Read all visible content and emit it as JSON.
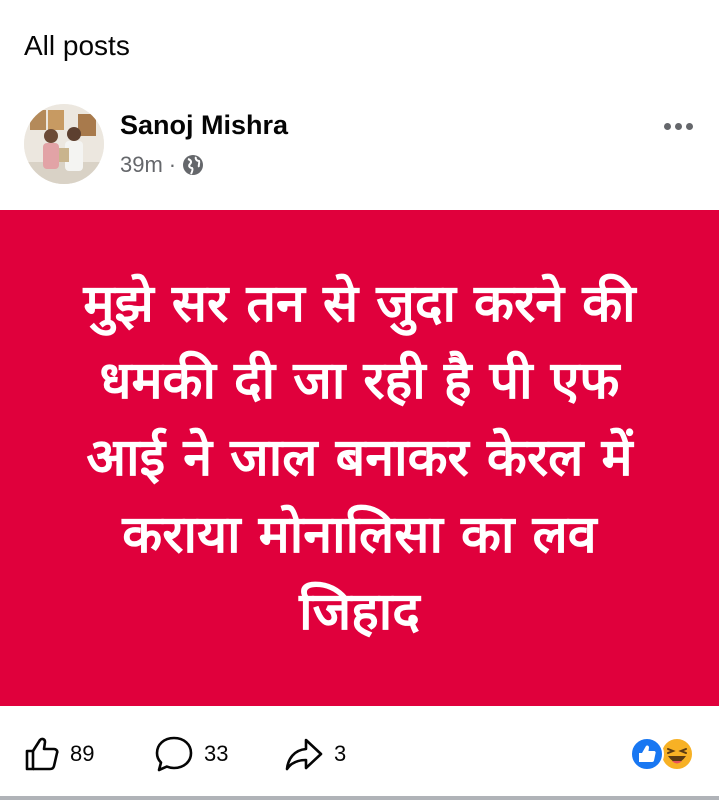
{
  "header": {
    "title": "All posts"
  },
  "post": {
    "author": "Sanoj Mishra",
    "time": "39m",
    "separator": "·",
    "privacy_icon": "globe-icon",
    "more_icon": "more-horizontal-icon",
    "avatar_description": "photo-avatar",
    "text": "मुझे सर तन से जुदा करने की धमकी दी जा रही है पी एफ आई ने जाल बनाकर केरल में कराया मोनालिसा का  लव जिहाद",
    "background_color": "#e0003c",
    "text_color": "#ffffff"
  },
  "actions": {
    "like": {
      "icon": "like-icon",
      "count": "89"
    },
    "comment": {
      "icon": "comment-icon",
      "count": "33"
    },
    "share": {
      "icon": "share-icon",
      "count": "3"
    }
  },
  "reactions": {
    "icons": [
      "like-reaction-icon",
      "haha-reaction-icon"
    ]
  },
  "colors": {
    "meta_gray": "#65676b",
    "like_blue": "#1877f2",
    "haha_yellow": "#f7b125"
  }
}
